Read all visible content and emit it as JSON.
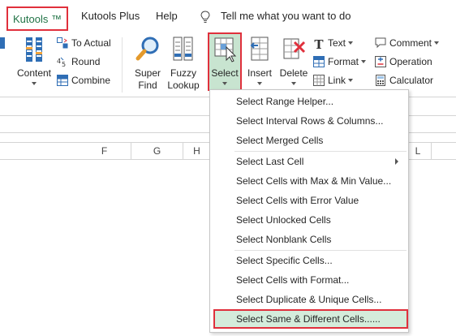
{
  "tabs": {
    "kutools": "Kutools ™",
    "kutools_plus": "Kutools Plus",
    "help": "Help",
    "tell_me": "Tell me what you want to do"
  },
  "ribbon": {
    "content": "Content",
    "to_actual": "To Actual",
    "round": "Round",
    "combine": "Combine",
    "super_find_1": "Super",
    "super_find_2": "Find",
    "fuzzy_lookup_1": "Fuzzy",
    "fuzzy_lookup_2": "Lookup",
    "select": "Select",
    "insert": "Insert",
    "delete": "Delete",
    "text": "Text",
    "format": "Format",
    "link": "Link",
    "comment": "Comment",
    "operation": "Operation",
    "calculator": "Calculator"
  },
  "columns": [
    "F",
    "G",
    "H",
    "L"
  ],
  "menu": {
    "items": [
      "Select Range Helper...",
      "Select Interval Rows & Columns...",
      "Select Merged Cells",
      "Select Last Cell",
      "Select Cells with Max & Min Value...",
      "Select Cells with Error Value",
      "Select Unlocked Cells",
      "Select Nonblank Cells",
      "Select Specific Cells...",
      "Select Cells with Format...",
      "Select Duplicate & Unique Cells...",
      "Select Same & Different Cells......"
    ]
  },
  "colors": {
    "accent_green": "#217346",
    "highlight_red": "#e0303c",
    "select_bg": "#c8e4d0"
  }
}
